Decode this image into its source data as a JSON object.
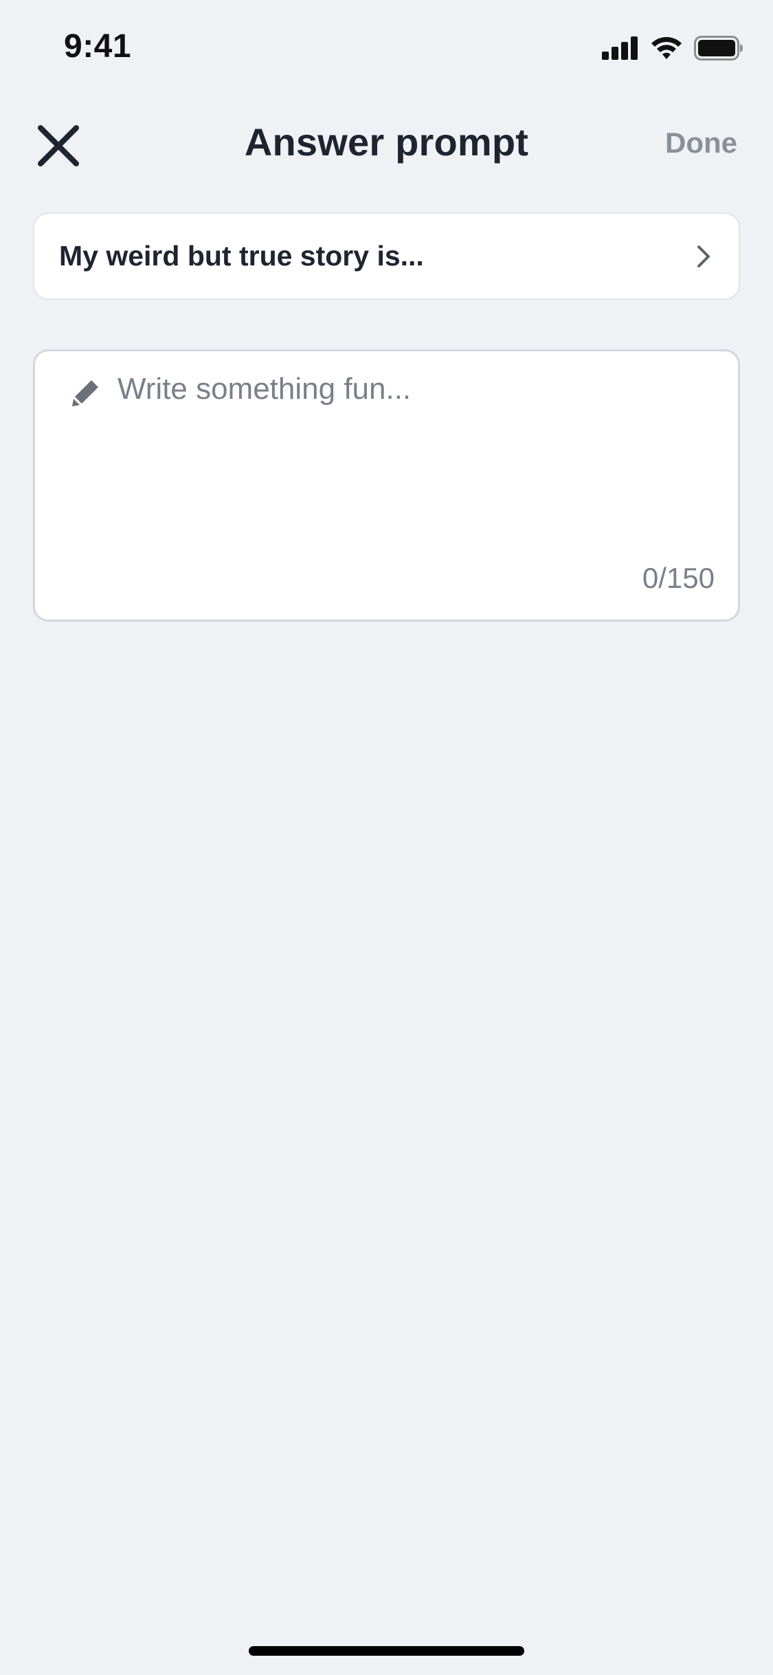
{
  "status_bar": {
    "time": "9:41",
    "icons": [
      "signal-icon",
      "wifi-icon",
      "battery-icon"
    ]
  },
  "header": {
    "close_icon": "close-icon",
    "title": "Answer prompt",
    "done_label": "Done"
  },
  "prompt": {
    "text": "My weird but true story is...",
    "chevron_icon": "chevron-right-icon"
  },
  "answer": {
    "value": "",
    "placeholder": "Write something fun...",
    "icon": "pencil-icon",
    "counter": "0/150"
  },
  "colors": {
    "background": "#F0F1F4",
    "card": "#FFFFFF",
    "title": "#1F2430",
    "muted": "#8A8F99",
    "placeholder": "#7A7F89"
  }
}
